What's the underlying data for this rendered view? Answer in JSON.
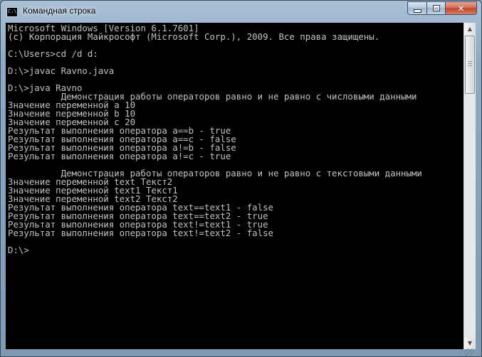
{
  "window": {
    "title": "Командная строка",
    "icon": "cmd-icon",
    "accent": "#8fa9c2",
    "buttons": {
      "minimize": "minimize-icon",
      "maximize": "maximize-icon",
      "close": "close-icon"
    }
  },
  "console": {
    "background": "#000000",
    "foreground": "#c0c0c0",
    "lines": [
      "Microsoft Windows [Version 6.1.7601]",
      "(c) Корпорация Майкрософт (Microsoft Corp.), 2009. Все права защищены.",
      "",
      "C:\\Users>cd /d d:",
      "",
      "D:\\>javac Ravno.java",
      "",
      "D:\\>java Ravno",
      "          Демонстрация работы операторов равно и не равно с числовыми данными",
      "Значение переменной a 10",
      "Значение переменной b 10",
      "Значение переменной c 20",
      "Результат выполнения оператора a==b - true",
      "Результат выполнения оператора a==c - false",
      "Результат выполнения оператора a!=b - false",
      "Результат выполнения оператора a!=c - true",
      "",
      "          Демонстрация работы операторов равно и не равно с текстовыми данными",
      "Значение переменной text Текст2",
      "Значение переменной text1 Текст1",
      "Значение переменной text2 Текст2",
      "Результат выполнения оператора text==text1 - false",
      "Результат выполнения оператора text==text2 - true",
      "Результат выполнения оператора text!=text1 - true",
      "Результат выполнения оператора text!=text2 - false",
      "",
      "D:\\>"
    ]
  },
  "scrollbar": {
    "up": "scroll-up-icon",
    "down": "scroll-down-icon"
  }
}
